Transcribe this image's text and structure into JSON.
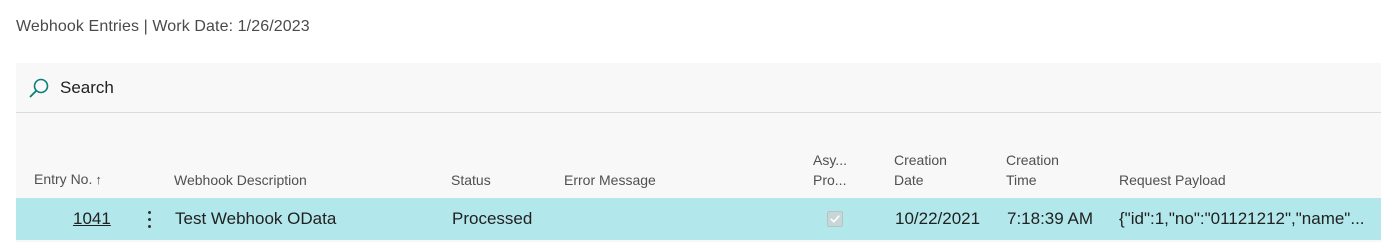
{
  "page": {
    "title": "Webhook Entries | Work Date: 1/26/2023"
  },
  "action_bar": {
    "search_label": "Search",
    "search_icon": "search-icon"
  },
  "table": {
    "columns": {
      "entry_no": "Entry No.",
      "entry_no_sort": "↑",
      "webhook_description": "Webhook Description",
      "status": "Status",
      "error_message": "Error Message",
      "async_line1": "Asy...",
      "async_line2": "Pro...",
      "creation_date_line1": "Creation",
      "creation_date_line2": "Date",
      "creation_time_line1": "Creation",
      "creation_time_line2": "Time",
      "request_payload": "Request Payload"
    },
    "rows": [
      {
        "entry_no": "1041",
        "webhook_description": "Test Webhook OData",
        "status": "Processed",
        "error_message": "",
        "async_processing": true,
        "creation_date": "10/22/2021",
        "creation_time": "7:18:39 AM",
        "request_payload": "{\"id\":1,\"no\":\"01121212\",\"name\"..."
      }
    ]
  },
  "colors": {
    "selected_row": "#b2e8ec",
    "search_icon": "#0a7f7a",
    "background": "#f8f8f8"
  }
}
